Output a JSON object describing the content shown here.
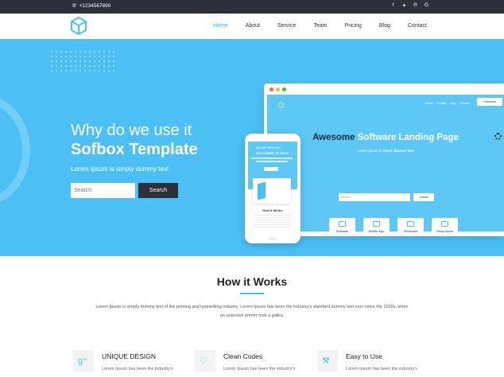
{
  "topbar": {
    "phone": "+1234567890",
    "socials": [
      "facebook-icon",
      "twitter-icon",
      "pinterest-icon",
      "google-icon"
    ]
  },
  "header": {
    "logo": "logo-cube-icon",
    "nav": [
      "Home",
      "About",
      "Service",
      "Team",
      "Pricing",
      "Blog",
      "Contact"
    ],
    "active_nav": "Home"
  },
  "hero": {
    "title_line1": "Why do we use it",
    "title_line2": "Sofbox Template",
    "subtitle": "Lorem Ipsum is simply dummy text",
    "search_placeholder": "Search",
    "search_button": "Search"
  },
  "browser_mock": {
    "nav": [
      "Home",
      "Contact",
      "Blog",
      "Contact"
    ],
    "button": "Download",
    "headline_dark": "Awesome",
    "headline_white": "Software Landing Page",
    "sub_plain": "Lorem Ipsum is simply ",
    "sub_bold": "dummy text",
    "input_placeholder": "Search",
    "input_button": "Submit",
    "cards": [
      "Software",
      "Mobile App",
      "Showcase",
      "Responsive"
    ]
  },
  "phone_mock": {
    "line1": "WE ARE BUILDING",
    "line2": "SOFTWARE TO HELP",
    "section_title": "How It Works"
  },
  "how": {
    "title": "How it Works",
    "description": "Lorem Ipsum is simply dummy text of the printing and typesetting industry. Lorem Ipsum has been the industry's standard dummy text ever since the 1500s, when an unknown printer took a galley.",
    "features": [
      {
        "icon": "google-plus-icon",
        "title": "UNIQUE DESIGN",
        "text": "Lorem Ipsum has been the industry's"
      },
      {
        "icon": "heart-icon",
        "title": "Clean Codes",
        "text": "Lorem Ipsum has been the industry's"
      },
      {
        "icon": "wrench-icon",
        "title": "Easy to Use",
        "text": "Lorem Ipsum has been the industry's"
      }
    ]
  },
  "colors": {
    "accent": "#4cc0f4",
    "dark": "#2d3039"
  }
}
